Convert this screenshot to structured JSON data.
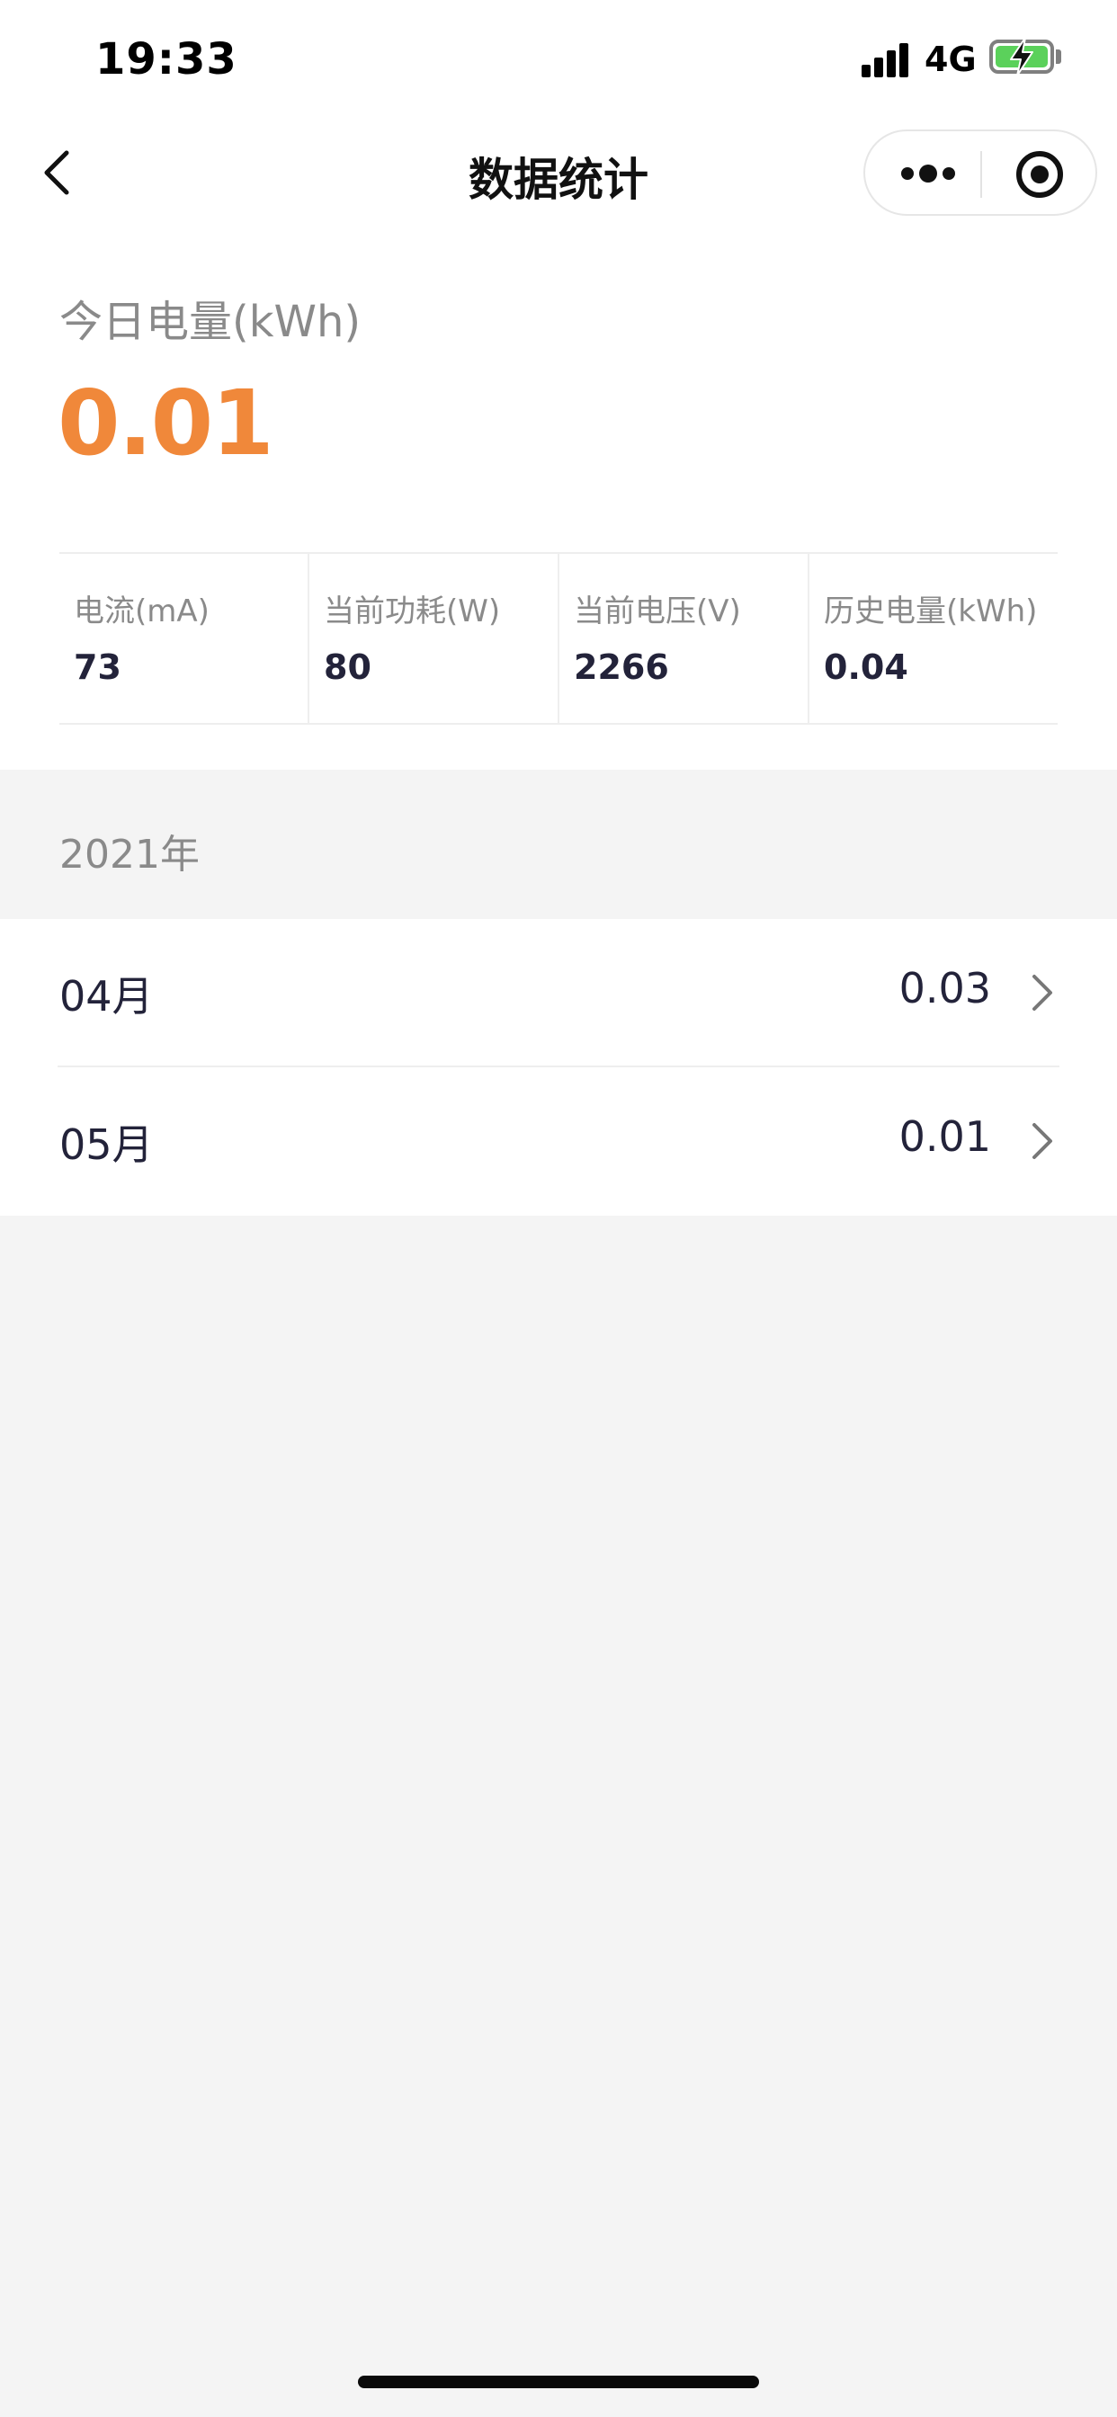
{
  "status_bar": {
    "time": "19:33",
    "network": "4G",
    "icons": [
      "signal-icon",
      "battery-charging-icon"
    ],
    "battery_color": "#5bd15b"
  },
  "nav": {
    "title": "数据统计",
    "icons": [
      "back-arrow-icon",
      "more-dots-icon",
      "close-target-icon"
    ]
  },
  "today": {
    "label": "今日电量(kWh)",
    "value": "0.01",
    "accent_color": "#f0883a"
  },
  "metrics": [
    {
      "label": "电流(mA)",
      "value": "73"
    },
    {
      "label": "当前功耗(W)",
      "value": "80"
    },
    {
      "label": "当前电压(V)",
      "value": "2266"
    },
    {
      "label": "历史电量(kWh)",
      "value": "0.04"
    }
  ],
  "year": {
    "label": "2021年",
    "months": [
      {
        "name": "04月",
        "value": "0.03"
      },
      {
        "name": "05月",
        "value": "0.01"
      }
    ]
  }
}
